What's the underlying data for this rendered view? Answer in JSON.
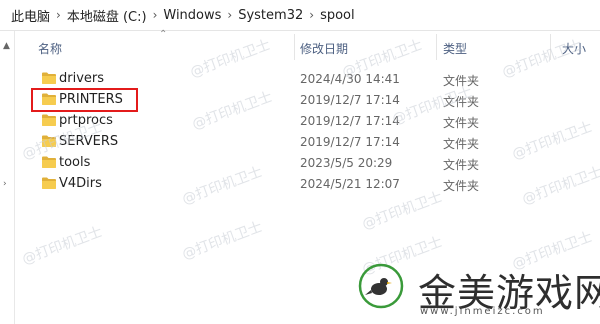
{
  "breadcrumb": {
    "items": [
      "此电脑",
      "本地磁盘 (C:)",
      "Windows",
      "System32",
      "spool"
    ],
    "separator": "›"
  },
  "columns": {
    "name": "名称",
    "modified": "修改日期",
    "type": "类型",
    "size": "大小"
  },
  "files": [
    {
      "name": "drivers",
      "modified": "2024/4/30 14:41",
      "type": "文件夹"
    },
    {
      "name": "PRINTERS",
      "modified": "2019/12/7 17:14",
      "type": "文件夹"
    },
    {
      "name": "prtprocs",
      "modified": "2019/12/7 17:14",
      "type": "文件夹"
    },
    {
      "name": "SERVERS",
      "modified": "2019/12/7 17:14",
      "type": "文件夹"
    },
    {
      "name": "tools",
      "modified": "2023/5/5 20:29",
      "type": "文件夹"
    },
    {
      "name": "V4Dirs",
      "modified": "2024/5/21 12:07",
      "type": "文件夹"
    }
  ],
  "watermark": "@打印机卫士",
  "logo": {
    "name": "金美游戏网",
    "url": "www.jinmeizc.com"
  },
  "colors": {
    "highlight": "#e31b1b",
    "folder": "#f6cc4f",
    "folder_dark": "#e0b03a",
    "header_text": "#4d6082"
  },
  "icons": {
    "folder": "folder-icon",
    "sort": "sort-ascending-icon"
  }
}
